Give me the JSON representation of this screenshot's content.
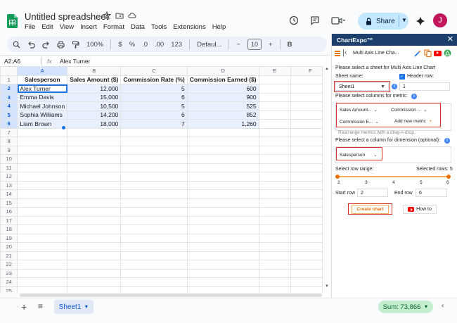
{
  "app": {
    "doc_title": "Untitled spreadsheet",
    "menu": [
      "File",
      "Edit",
      "View",
      "Insert",
      "Format",
      "Data",
      "Tools",
      "Extensions",
      "Help"
    ],
    "share_label": "Share",
    "avatar_initial": "J",
    "colors": {
      "accent": "#1a73e8",
      "share_bg": "#c2e7ff",
      "panel_header": "#1c3f6e",
      "highlight": "#d93025",
      "orange": "#e8710a"
    }
  },
  "toolbar": {
    "zoom": "100%",
    "currency": "$",
    "percent": "%",
    "dec_decrease": ".0",
    "dec_increase": ".00",
    "number_format": "123",
    "font": "Defaul...",
    "font_size": "10",
    "bold": "B",
    "font_minus": "−",
    "font_plus": "+"
  },
  "formula_bar": {
    "name_box": "A2:A6",
    "fx": "fx",
    "value": "Alex Turner"
  },
  "grid": {
    "columns": [
      "A",
      "B",
      "C",
      "D",
      "E",
      "F"
    ],
    "rows": [
      "1",
      "2",
      "3",
      "4",
      "5",
      "6",
      "7",
      "8",
      "9",
      "10",
      "11",
      "12",
      "13",
      "14",
      "15",
      "16",
      "17",
      "18",
      "19",
      "20",
      "21",
      "22",
      "23",
      "24",
      "25"
    ],
    "headers": [
      "Salesperson",
      "Sales Amount ($)",
      "Commission Rate (%)",
      "Commission Earned ($)"
    ],
    "data": [
      [
        "Alex Turner",
        "12,000",
        "5",
        "600"
      ],
      [
        "Emma Davis",
        "15,000",
        "6",
        "900"
      ],
      [
        "Michael Johnson",
        "10,500",
        "5",
        "525"
      ],
      [
        "Sophia Williams",
        "14,200",
        "6",
        "852"
      ],
      [
        "Liam Brown",
        "18,000",
        "7",
        "1,260"
      ]
    ]
  },
  "bottom": {
    "sheet_tab": "Sheet1",
    "sum": "Sum: 73,866"
  },
  "panel": {
    "title": "ChartExpo™",
    "close": "✕",
    "chart_name": "Multi Axis Line Cha...",
    "select_sheet_label": "Please select a sheet for Multi Axis Line Chart",
    "sheet_name_label": "Sheet name:",
    "sheet_value": "Sheet1",
    "header_row_label": "Header row:",
    "header_row_value": "1",
    "metric_label": "Please select columns for metric:",
    "metrics": [
      "Sales Amount...",
      "Commission ...",
      "Commission E..."
    ],
    "add_metric": "Add new metric",
    "rearrange_hint": "Rearrange metrics with a drag-n-drop.",
    "dimension_label": "Please select a column for dimension (optional):",
    "dimension_value": "Salesperson",
    "row_range_label": "Select row range:",
    "selected_rows_label": "Selected rows: 5",
    "ticks": [
      "2",
      "3",
      "4",
      "5",
      "6"
    ],
    "start_row_label": "Start row",
    "start_row_value": "2",
    "end_row_label": "End row",
    "end_row_value": "6",
    "create_chart": "Create chart",
    "how_to": "How to"
  }
}
